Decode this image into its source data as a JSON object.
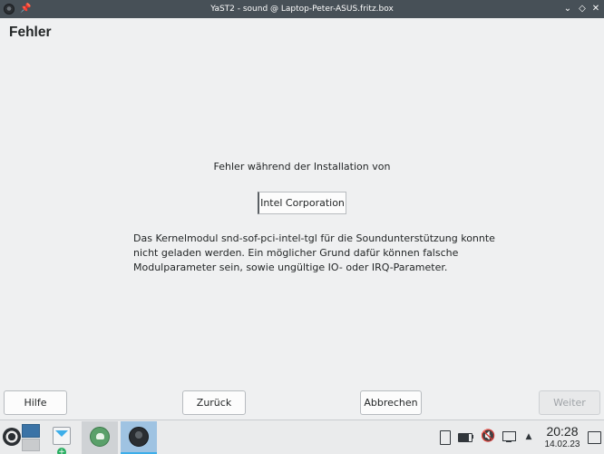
{
  "window": {
    "title": "YaST2 - sound @ Laptop-Peter-ASUS.fritz.box",
    "app_icon": "yast-icon",
    "pin_glyph": "📌",
    "min_glyph": "⌄",
    "max_glyph": "◇",
    "close_glyph": "✕"
  },
  "page": {
    "title": "Fehler",
    "error_label": "Fehler während der Installation von",
    "vendor": "Intel Corporation",
    "message": "Das Kernelmodul snd-sof-pci-intel-tgl für die Soundunterstützung konnte nicht geladen werden. Ein möglicher Grund dafür können falsche Modulparameter sein, sowie ungültige IO- oder IRQ-Parameter."
  },
  "buttons": {
    "help": "Hilfe",
    "back": "Zurück",
    "abort": "Abbrechen",
    "next": "Weiter"
  },
  "taskbar": {
    "arrow_glyph": "▲",
    "audio_glyph": "🔇",
    "time": "20:28",
    "date": "14.02.23",
    "apps": [
      "mail-icon",
      "chameleon-icon",
      "yast-icon"
    ]
  },
  "colors": {
    "titlebar": "#475057",
    "accent": "#3daee9",
    "muted_audio": "#da4453"
  }
}
